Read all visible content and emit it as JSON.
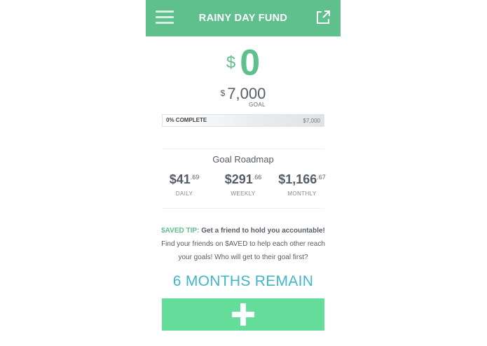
{
  "header": {
    "title": "RAINY DAY FUND",
    "menu_icon": "hamburger-menu-icon",
    "share_icon": "external-share-icon",
    "background": "#5fbf8d"
  },
  "balance": {
    "currency": "$",
    "amount": "0"
  },
  "goal": {
    "currency": "$",
    "amount": "7,000",
    "label": "GOAL"
  },
  "progress": {
    "percent": 0,
    "label": "0% COMPLETE",
    "goal_text": "$7,000"
  },
  "roadmap": {
    "title": "Goal Roadmap",
    "items": [
      {
        "dollars": "$41",
        "cents": ".69",
        "label": "DAILY"
      },
      {
        "dollars": "$291",
        "cents": ".66",
        "label": "WEEKLY"
      },
      {
        "dollars": "$1,166",
        "cents": ".67",
        "label": "MONTHLY"
      }
    ]
  },
  "tip": {
    "label": "$AVED TIP:",
    "title": "Get a friend to hold you accountable!",
    "line1": "Find your friends on $AVED to help each other reach",
    "line2": "your goals! Who will get to their goal first?"
  },
  "remaining": {
    "text": "6 MONTHS REMAIN",
    "color": "#3fb6c9"
  },
  "add_button": {
    "icon": "plus-icon",
    "color": "#64dc9a"
  }
}
